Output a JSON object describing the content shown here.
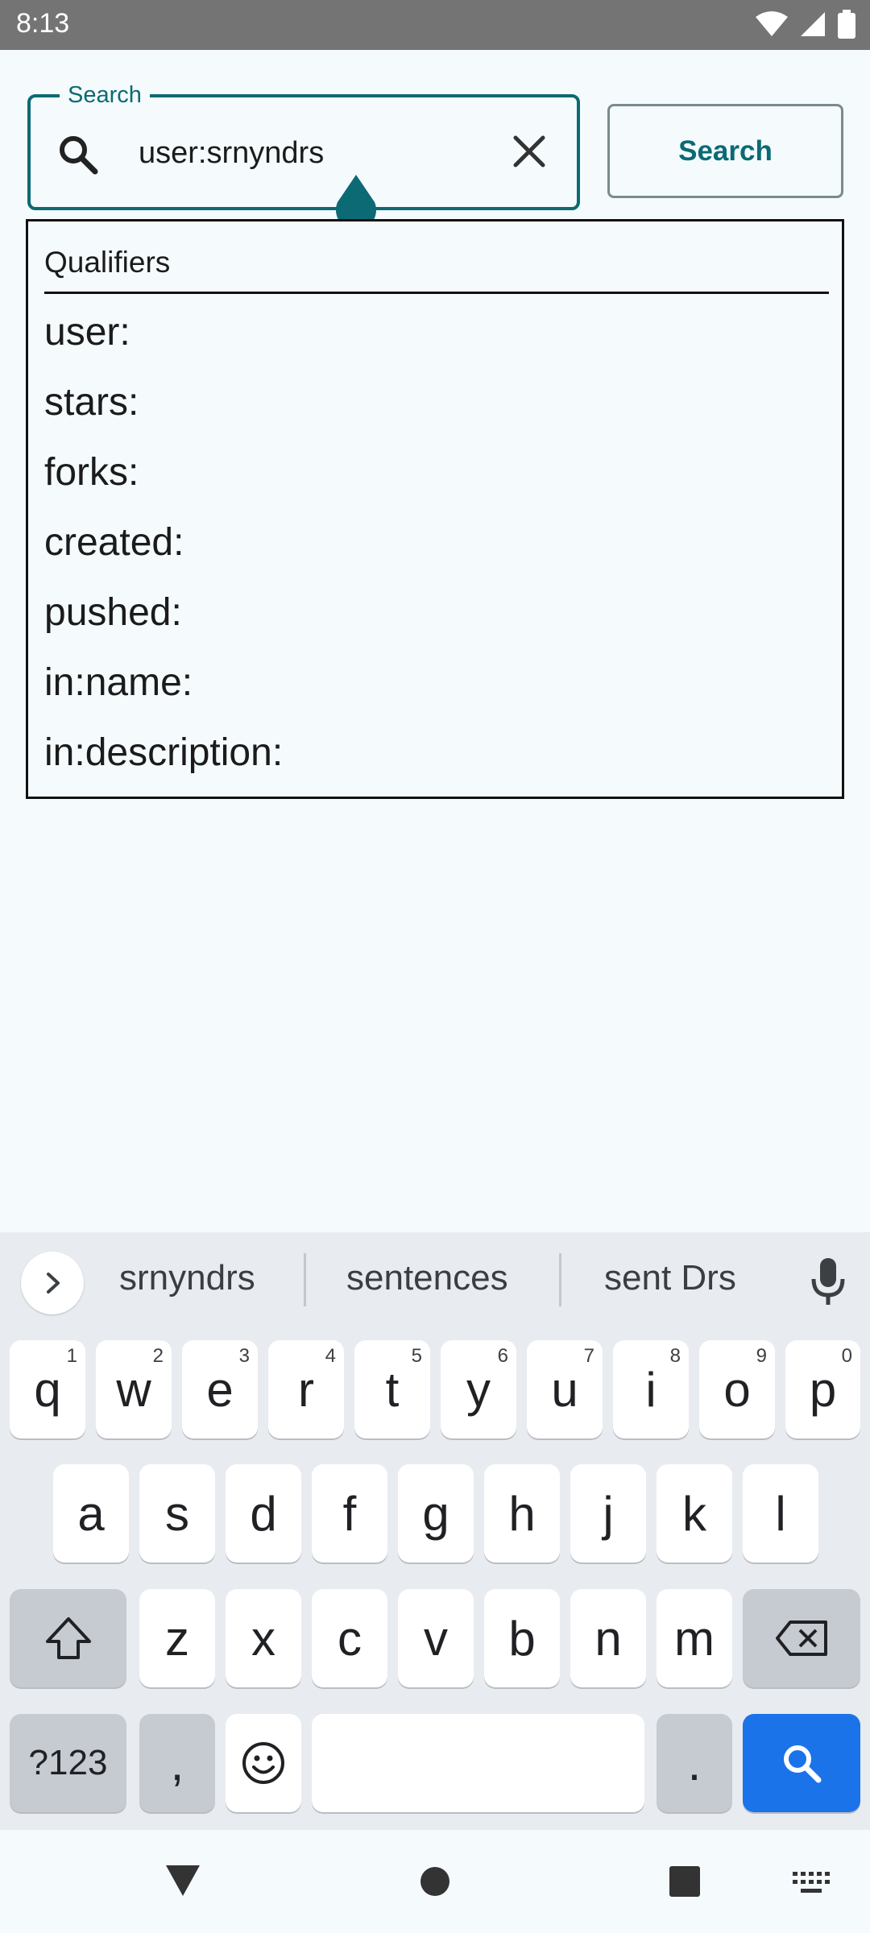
{
  "status_bar": {
    "time": "8:13"
  },
  "search": {
    "label": "Search",
    "value": "user:srnyndrs",
    "button_label": "Search"
  },
  "qualifiers": {
    "header": "Qualifiers",
    "items": [
      "user:",
      "stars:",
      "forks:",
      "created:",
      "pushed:",
      "in:name:",
      "in:description:"
    ]
  },
  "keyboard": {
    "suggestions": [
      "srnyndrs",
      "sentences",
      "sent Drs"
    ],
    "row1": [
      {
        "key": "q",
        "hint": "1"
      },
      {
        "key": "w",
        "hint": "2"
      },
      {
        "key": "e",
        "hint": "3"
      },
      {
        "key": "r",
        "hint": "4"
      },
      {
        "key": "t",
        "hint": "5"
      },
      {
        "key": "y",
        "hint": "6"
      },
      {
        "key": "u",
        "hint": "7"
      },
      {
        "key": "i",
        "hint": "8"
      },
      {
        "key": "o",
        "hint": "9"
      },
      {
        "key": "p",
        "hint": "0"
      }
    ],
    "row2": [
      "a",
      "s",
      "d",
      "f",
      "g",
      "h",
      "j",
      "k",
      "l"
    ],
    "row3": [
      "z",
      "x",
      "c",
      "v",
      "b",
      "n",
      "m"
    ],
    "symbols_label": "?123",
    "comma_label": ",",
    "period_label": "."
  },
  "colors": {
    "accent": "#0b6a74",
    "keyboard_action": "#1a73e8"
  }
}
